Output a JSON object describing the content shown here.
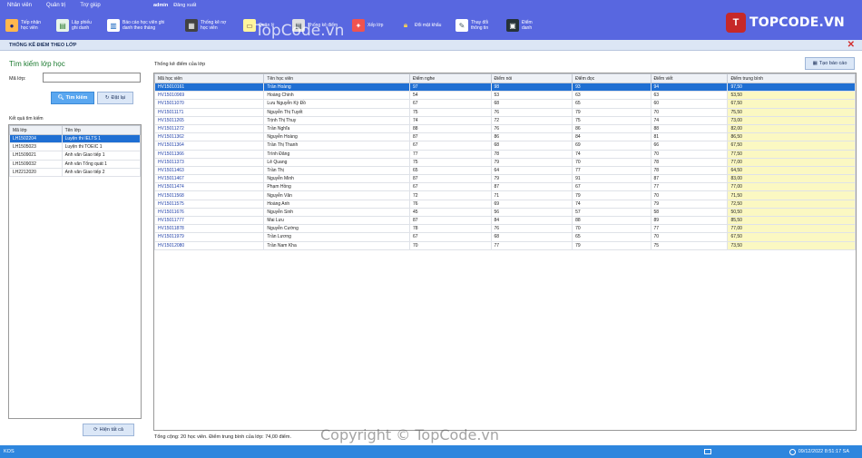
{
  "menu": {
    "items": [
      "Nhân viên",
      "Quản trị",
      "Trợ giúp"
    ],
    "user": "admin",
    "logout": "Đăng xuất"
  },
  "toolbar": [
    {
      "icon": "student-icon",
      "label": "Tiếp nhận\nhọc viên"
    },
    {
      "icon": "receipt-icon",
      "label": "Lập phiếu\nghi danh"
    },
    {
      "icon": "report-chart-icon",
      "label": "Báo cáo học viên ghi\ndanh theo tháng"
    },
    {
      "icon": "debt-stats-icon",
      "label": "Thống kê nợ\nhọc viên"
    },
    {
      "icon": "manage-icon",
      "label": "Quản lý"
    },
    {
      "icon": "score-stats-icon",
      "label": "Thống kê điểm"
    },
    {
      "icon": "class-arrange-icon",
      "label": "Xếp lớp"
    },
    {
      "icon": "lock-icon",
      "label": "Đổi mật khẩu"
    },
    {
      "icon": "edit-info-icon",
      "label": "Thay đổi\nthông tin"
    },
    {
      "icon": "attendance-icon",
      "label": "Điểm\ndanh"
    }
  ],
  "logo": {
    "mark": "T",
    "text": "TOPCODE.VN"
  },
  "window_title": "THỐNG KÊ ĐIỂM THEO LỚP",
  "search": {
    "heading": "Tìm kiếm lớp học",
    "class_code_label": "Mã lớp:",
    "class_code_value": "",
    "search_button": "Tìm kiếm",
    "reset_button": "Đặt lại",
    "results_label": "Kết quả tìm kiếm",
    "columns": [
      "Mã lớp",
      "Tên lớp"
    ],
    "rows": [
      [
        "LH1502204",
        "Luyện thi IELTS 1"
      ],
      [
        "LH1505023",
        "Luyện thi TOEIC 1"
      ],
      [
        "LH1509021",
        "Anh văn Giao tiếp 1"
      ],
      [
        "LH1509032",
        "Anh văn Tổng quát 1"
      ],
      [
        "LH2212020",
        "Anh văn Giao tiếp 2"
      ]
    ],
    "selected_row": 0,
    "show_all_button": "Hiện tất cả"
  },
  "stats": {
    "caption": "Thống kê điểm của lớp",
    "report_button": "Tạo báo cáo",
    "columns": [
      "Mã học viên",
      "Tên học viên",
      "Điểm nghe",
      "Điểm nói",
      "Điểm đọc",
      "Điểm viết",
      "Điểm trung bình"
    ],
    "rows": [
      [
        "HV15010161",
        "Trần Hoàng",
        "97",
        "98",
        "93",
        "94",
        "97,50"
      ],
      [
        "HV15010969",
        "Hoàng Chinh",
        "54",
        "53",
        "63",
        "63",
        "53,50"
      ],
      [
        "HV15011070",
        "Lưu Nguyễn Kỳ Đồ",
        "67",
        "68",
        "65",
        "60",
        "67,50"
      ],
      [
        "HV15011171",
        "Nguyễn Thị Tuyết",
        "75",
        "76",
        "79",
        "70",
        "75,50"
      ],
      [
        "HV15011265",
        "Trịnh Thị Thuy",
        "74",
        "72",
        "75",
        "74",
        "73,00"
      ],
      [
        "HV15011272",
        "Trần Nghĩa",
        "88",
        "76",
        "86",
        "88",
        "82,00"
      ],
      [
        "HV15011362",
        "Nguyễn Hoàng",
        "87",
        "86",
        "84",
        "81",
        "86,50"
      ],
      [
        "HV15011364",
        "Trần Thị Thanh",
        "67",
        "68",
        "69",
        "66",
        "67,50"
      ],
      [
        "HV15011366",
        "Trình Đăng",
        "77",
        "78",
        "74",
        "70",
        "77,50"
      ],
      [
        "HV15011373",
        "Lê Quang",
        "75",
        "79",
        "70",
        "78",
        "77,00"
      ],
      [
        "HV15011463",
        "Trần Thị",
        "65",
        "64",
        "77",
        "78",
        "64,50"
      ],
      [
        "HV15011467",
        "Nguyễn Minh",
        "87",
        "79",
        "91",
        "87",
        "83,00"
      ],
      [
        "HV15011474",
        "Phạm Hồng",
        "67",
        "87",
        "67",
        "77",
        "77,00"
      ],
      [
        "HV15011568",
        "Nguyễn Văn",
        "72",
        "71",
        "79",
        "70",
        "71,50"
      ],
      [
        "HV15011575",
        "Hoàng Anh",
        "76",
        "69",
        "74",
        "79",
        "72,50"
      ],
      [
        "HV15011676",
        "Nguyễn Sinh",
        "45",
        "56",
        "57",
        "58",
        "50,50"
      ],
      [
        "HV15011777",
        "Mai Lưu",
        "87",
        "84",
        "88",
        "89",
        "85,50"
      ],
      [
        "HV15011878",
        "Nguyễn Cường",
        "78",
        "76",
        "70",
        "77",
        "77,00"
      ],
      [
        "HV15011979",
        "Trần Lương",
        "67",
        "68",
        "65",
        "70",
        "67,50"
      ],
      [
        "HV15012080",
        "Trần Nam Kha",
        "70",
        "77",
        "79",
        "75",
        "73,50"
      ]
    ],
    "selected_row": 0,
    "summary": "Tổng cộng: 20 học viên. Điểm trung bình của lớp: 74,00 điểm."
  },
  "status": {
    "left": "KOS",
    "datetime": "09/12/2022 8:51:17 SA"
  },
  "watermark": {
    "top": "TopCode.vn",
    "bottom": "Copyright © TopCode.vn"
  },
  "colors": {
    "chrome": "#5867e0",
    "selection": "#1f6fd3",
    "avg_cell": "#fbf8c2",
    "status": "#2e86de"
  }
}
